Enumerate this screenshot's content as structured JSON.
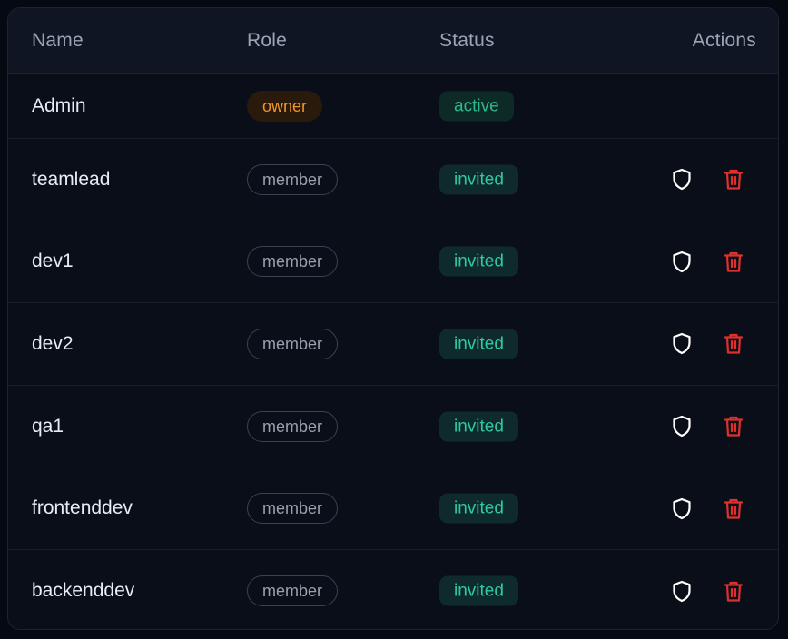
{
  "columns": {
    "name": "Name",
    "role": "Role",
    "status": "Status",
    "actions": "Actions"
  },
  "rows": [
    {
      "name": "Admin",
      "role": "owner",
      "status": "active",
      "has_actions": false
    },
    {
      "name": "teamlead",
      "role": "member",
      "status": "invited",
      "has_actions": true
    },
    {
      "name": "dev1",
      "role": "member",
      "status": "invited",
      "has_actions": true
    },
    {
      "name": "dev2",
      "role": "member",
      "status": "invited",
      "has_actions": true
    },
    {
      "name": "qa1",
      "role": "member",
      "status": "invited",
      "has_actions": true
    },
    {
      "name": "frontenddev",
      "role": "member",
      "status": "invited",
      "has_actions": true
    },
    {
      "name": "backenddev",
      "role": "member",
      "status": "invited",
      "has_actions": true
    }
  ],
  "icons": {
    "permissions": "shield-icon",
    "delete": "trash-icon"
  },
  "colors": {
    "owner_text": "#f0952a",
    "owner_bg": "#2a1a0c",
    "member_text": "#9aa0ad",
    "status_text": "#2fc9a4",
    "status_bg": "#0f2a2a",
    "delete_icon": "#e0302d",
    "shield_icon": "#ffffff"
  }
}
